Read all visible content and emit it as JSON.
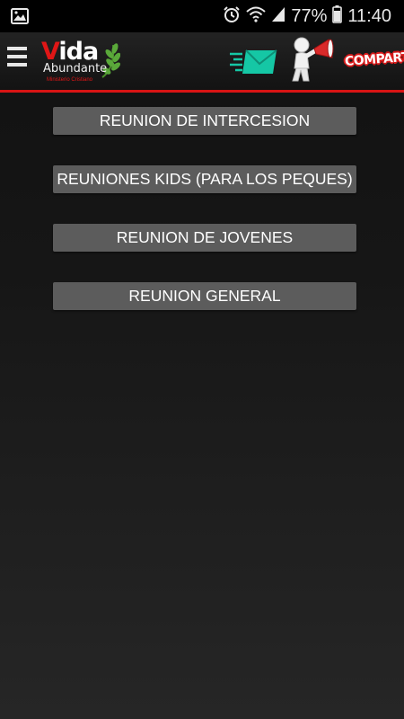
{
  "status_bar": {
    "battery_percent": "77%",
    "time": "11:40",
    "icons": [
      "image-icon",
      "alarm-icon",
      "wifi-icon",
      "signal-icon",
      "battery-icon"
    ]
  },
  "app_bar": {
    "logo": {
      "vida_first": "V",
      "vida_rest": "ida",
      "abundante": "Abundante",
      "subtitle": "Ministerio Cristiano"
    },
    "share_label": "COMPARTE",
    "colors": {
      "accent": "#d81414",
      "mail": "#15c7a5",
      "button": "#5c5c5c"
    }
  },
  "menu": {
    "items": [
      {
        "label": "REUNION DE INTERCESION"
      },
      {
        "label": "REUNIONES KIDS (PARA LOS PEQUES)"
      },
      {
        "label": "REUNION DE JOVENES"
      },
      {
        "label": "REUNION GENERAL"
      }
    ]
  }
}
